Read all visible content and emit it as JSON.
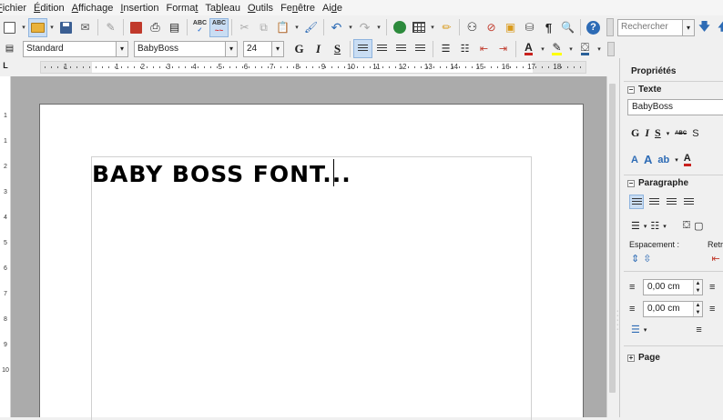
{
  "menu": {
    "items": [
      {
        "prefix": "",
        "underline": "F",
        "rest": "ichier"
      },
      {
        "prefix": "",
        "underline": "É",
        "rest": "dition"
      },
      {
        "prefix": "",
        "underline": "A",
        "rest": "ffichage"
      },
      {
        "prefix": "",
        "underline": "I",
        "rest": "nsertion"
      },
      {
        "prefix": "Forma",
        "underline": "t",
        "rest": ""
      },
      {
        "prefix": "Ta",
        "underline": "b",
        "rest": "leau"
      },
      {
        "prefix": "",
        "underline": "O",
        "rest": "utils"
      },
      {
        "prefix": "Fe",
        "underline": "n",
        "rest": "être"
      },
      {
        "prefix": "Ai",
        "underline": "d",
        "rest": "e"
      }
    ]
  },
  "toolbar": {
    "search_placeholder": "Rechercher",
    "spellcheck_label": "ABC",
    "help_glyph": "?",
    "pilcrow": "¶"
  },
  "format_bar": {
    "paragraph_style": "Standard",
    "font_name": "BabyBoss",
    "font_size": "24",
    "bold_label": "G",
    "italic_label": "I",
    "underline_label": "S"
  },
  "ruler": {
    "corner": "L",
    "numbers": [
      "1",
      "1",
      "2",
      "3",
      "4",
      "5",
      "6",
      "7",
      "8",
      "9",
      "10",
      "11",
      "12",
      "13",
      "14",
      "15",
      "16",
      "17",
      "18"
    ],
    "vnumbers": [
      "1",
      "1",
      "2",
      "3",
      "4",
      "5",
      "6",
      "7",
      "8",
      "9",
      "10"
    ]
  },
  "document": {
    "text": "BABY BOSS FONT..."
  },
  "sidebar": {
    "title": "Propriétés",
    "text_section": "Texte",
    "font_name": "BabyBoss",
    "bold_label": "G",
    "italic_label": "I",
    "underline_label": "S",
    "strike_label": "ABC",
    "paragraph_section": "Paragraphe",
    "spacing_label": "Espacement :",
    "indent_label": "Retra",
    "spacing_above": "0,00 cm",
    "spacing_below": "0,00 cm",
    "page_section": "Page"
  }
}
